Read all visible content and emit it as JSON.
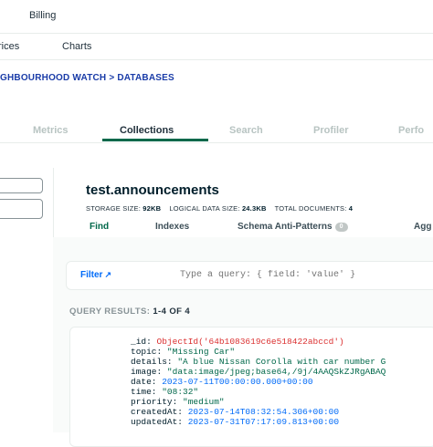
{
  "topbar": {
    "billing": "Billing"
  },
  "subnav": {
    "services": "rices",
    "charts": "Charts"
  },
  "breadcrumb": "GHBOURHOOD WATCH > DATABASES",
  "tabs": [
    {
      "label": "Metrics"
    },
    {
      "label": "Collections"
    },
    {
      "label": "Search"
    },
    {
      "label": "Profiler"
    },
    {
      "label": "Perfo"
    }
  ],
  "collection": {
    "namespace": "test.announcements",
    "storage_label": "STORAGE SIZE:",
    "storage_value": "92KB",
    "logical_label": "LOGICAL DATA SIZE:",
    "logical_value": "24.3KB",
    "total_label": "TOTAL DOCUMENTS:",
    "total_value": "4"
  },
  "subtabs": {
    "find": "Find",
    "indexes": "Indexes",
    "schema": "Schema Anti-Patterns",
    "schema_badge": "0",
    "agg": "Agg"
  },
  "filter": {
    "label": "Filter",
    "placeholder": "Type a query: { field: 'value' }"
  },
  "results": {
    "label": "QUERY RESULTS:",
    "range": "1-4 OF 4"
  },
  "document": {
    "id_key": "_id:",
    "id_value": "ObjectId('64b1083619c6e518422abccd')",
    "topic_key": "topic:",
    "topic_value": "\"Missing Car\"",
    "details_key": "details:",
    "details_value": "\"A blue Nissan Corolla with car number G",
    "image_key": "image:",
    "image_value": "\"data:image/jpeg;base64,/9j/4AAQSkZJRgABAQ",
    "date_key": "date:",
    "date_value": "2023-07-11T00:00:00.000+00:00",
    "time_key": "time:",
    "time_value": "\"08:32\"",
    "priority_key": "priority:",
    "priority_value": "\"medium\"",
    "created_key": "createdAt:",
    "created_value": "2023-07-14T08:32:54.306+00:00",
    "updated_key": "updatedAt:",
    "updated_value": "2023-07-31T07:17:09.813+00:00"
  }
}
